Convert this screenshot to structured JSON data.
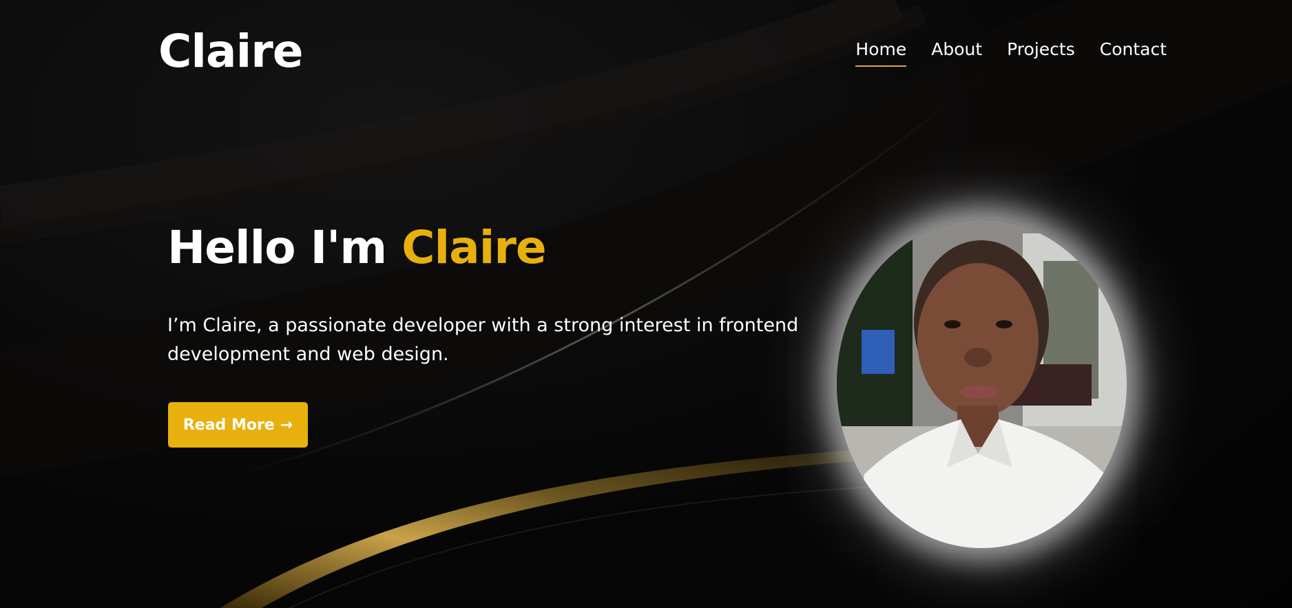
{
  "header": {
    "logo": "Claire"
  },
  "nav": {
    "items": [
      {
        "label": "Home",
        "active": true
      },
      {
        "label": "About",
        "active": false
      },
      {
        "label": "Projects",
        "active": false
      },
      {
        "label": "Contact",
        "active": false
      }
    ]
  },
  "hero": {
    "greeting": "Hello I'm",
    "name": "Claire",
    "description": "I’m Claire, a passionate developer with a strong interest in frontend development and web design.",
    "cta_label": "Read More",
    "cta_arrow": "→"
  },
  "colors": {
    "accent": "#e8b00c",
    "nav_underline": "#e8a43a",
    "background": "#050505"
  },
  "icons": {
    "cta_icon": "arrow-right-icon"
  }
}
